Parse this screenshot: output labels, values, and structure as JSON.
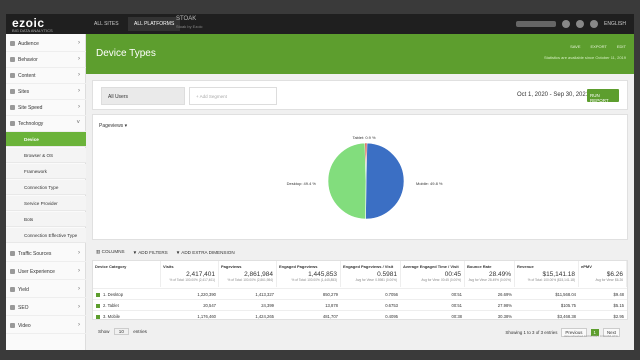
{
  "topbar": {
    "logo": "ezoic",
    "logo_sub": "BIG DATA ANALYTICS",
    "tabs": [
      "ALL SITES",
      "ALL PLATFORMS"
    ],
    "brand": "STOAK",
    "brand_sub": "Stoak by Ezoic",
    "lang": "ENGLISH"
  },
  "sidebar": {
    "items": [
      {
        "label": "Audience"
      },
      {
        "label": "Behavior"
      },
      {
        "label": "Content"
      },
      {
        "label": "Sites"
      },
      {
        "label": "Site Speed"
      },
      {
        "label": "Technology"
      }
    ],
    "subitems": [
      {
        "label": "Device"
      },
      {
        "label": "Browser & OS"
      },
      {
        "label": "Framework"
      },
      {
        "label": "Connection Type"
      },
      {
        "label": "Service Provider"
      },
      {
        "label": "Bots"
      },
      {
        "label": "Connection Effective Type"
      }
    ],
    "lower_items": [
      {
        "label": "Traffic Sources"
      },
      {
        "label": "User Experience"
      },
      {
        "label": "Yield"
      },
      {
        "label": "SEO"
      },
      {
        "label": "Video"
      }
    ]
  },
  "header": {
    "title": "Device Types",
    "actions": [
      "SAVE",
      "EXPORT",
      "EDIT"
    ],
    "note": "Statistics are available since October 11, 2019"
  },
  "filters": {
    "segment": "All Users",
    "add_segment": "+ Add Segment",
    "date_range": "Oct 1, 2020 - Sep 30, 2021",
    "run_button": "RUN REPORT"
  },
  "chart_data": {
    "type": "pie",
    "metric": "Pageviews",
    "slices": [
      {
        "label": "Mobile",
        "value": 49.8,
        "label_text": "Mobile: 49.8 %",
        "color": "#3b6fc4"
      },
      {
        "label": "Desktop",
        "value": 49.4,
        "label_text": "Desktop: 49.4 %",
        "color": "#82dd7d"
      },
      {
        "label": "Tablet",
        "value": 0.9,
        "label_text": "Tablet: 0.9 %",
        "color": "#c9362b"
      }
    ]
  },
  "toolbar": {
    "columns": "COLUMNS",
    "add_filters": "ADD FILTERS",
    "add_dimension": "ADD EXTRA DIMENSION"
  },
  "table": {
    "headers": [
      "Device Category",
      "Visits",
      "Pageviews",
      "Engaged Pageviews",
      "Engaged Pageviews / Visit",
      "Average Engaged Time / Visit",
      "Bounce Rate",
      "Revenue",
      "ePMV"
    ],
    "totals": [
      {
        "value": "",
        "sub": ""
      },
      {
        "value": "2,417,401",
        "sub": "% of Total: 100.00% (2,417,401)"
      },
      {
        "value": "2,861,984",
        "sub": "% of Total: 100.00% (2,861,984)"
      },
      {
        "value": "1,445,853",
        "sub": "% of Total: 100.00% (1,445,853)"
      },
      {
        "value": "0.5981",
        "sub": "Avg for View: 0.5981 (0.00%)"
      },
      {
        "value": "00:45",
        "sub": "Avg for View: 00:45 (0.00%)"
      },
      {
        "value": "28.49%",
        "sub": "Avg for View: 28.49% (0.00%)"
      },
      {
        "value": "$15,141.18",
        "sub": "% of Total: 100.00% ($15,141.18)"
      },
      {
        "value": "$6.26",
        "sub": "Avg for View: $6.26"
      }
    ],
    "rows": [
      [
        "Desktop",
        "1,220,390",
        "1,413,327",
        "850,279",
        "0.7056",
        "00:51",
        "26.69%",
        "$11,568.04",
        "$9.48"
      ],
      [
        "Tablet",
        "20,547",
        "24,399",
        "13,878",
        "0.6753",
        "00:51",
        "27.98%",
        "$105.75",
        "$5.15"
      ],
      [
        "Mobile",
        "1,176,460",
        "1,424,265",
        "481,707",
        "0.4095",
        "00:38",
        "30.38%",
        "$3,468.38",
        "$2.95"
      ]
    ],
    "show_label": "Show",
    "show_value": "10",
    "entries_label": "entries",
    "paging_text": "Showing 1 to 3 of 3 entries",
    "previous": "Previous",
    "page": "1",
    "next": "Next",
    "footer_note": "data refreshed 10/01/2021 4:00 PM UTC"
  }
}
